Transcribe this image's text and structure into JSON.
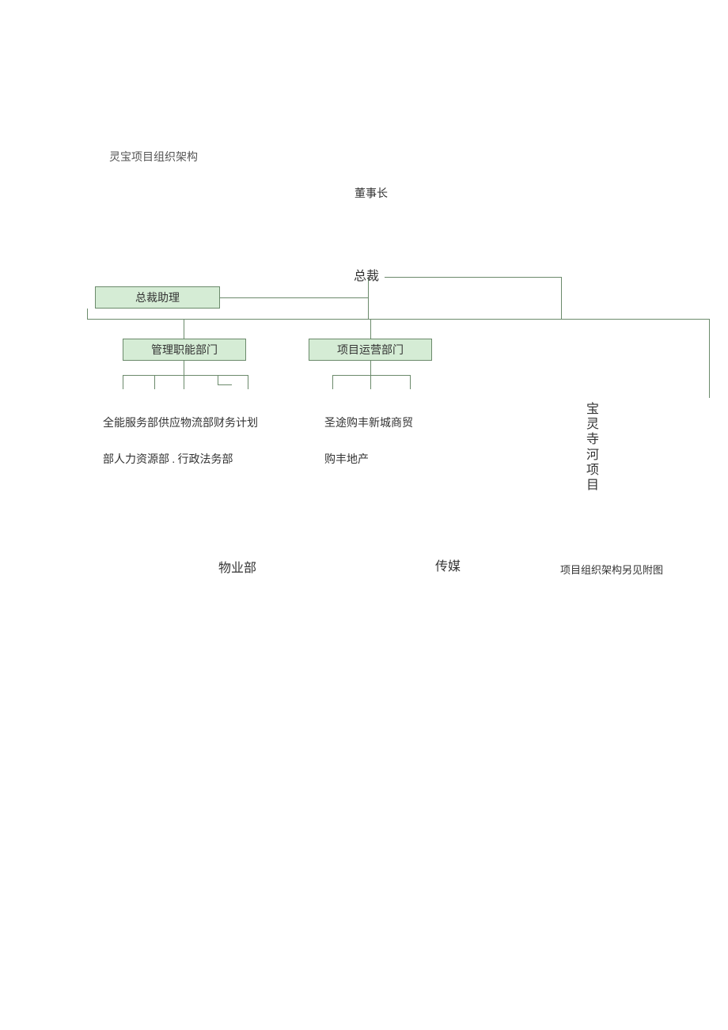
{
  "title": "灵宝项目组织架构",
  "nodes": {
    "chairman": "董事长",
    "president": "总裁",
    "assistant": "总裁助理",
    "mgmt_dept": "管理职能部门",
    "ops_dept": "项目运营部门"
  },
  "mgmt_children_line1": "全能服务部供应物流部财务计划",
  "mgmt_children_line2": "部人力资源部 . 行政法务部",
  "ops_children_line1": "圣途购丰新城商贸",
  "ops_children_line2": "购丰地产",
  "project_vertical": "宝灵寺河项目",
  "bottom": {
    "property": "物业部",
    "media": "传媒",
    "note": "项目组织架构另见附图"
  }
}
